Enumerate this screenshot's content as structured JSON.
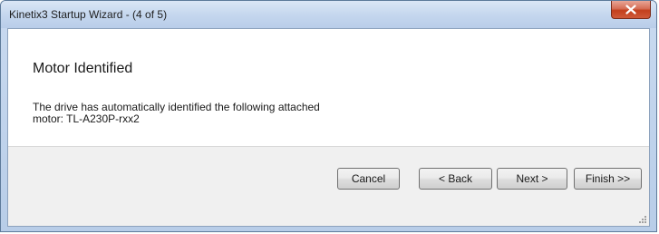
{
  "window": {
    "title": "Kinetix3 Startup Wizard - (4 of 5)",
    "close_icon": "close-icon"
  },
  "page": {
    "heading": "Motor Identified",
    "line1": "The drive has automatically identified the following attached",
    "line2": "motor: TL-A230P-rxx2"
  },
  "buttons": {
    "cancel": "Cancel",
    "back": "< Back",
    "next": "Next >",
    "finish": "Finish >>"
  },
  "colors": {
    "title_bar": "#c5d7ee",
    "close_button": "#c33f1c",
    "content_bg": "#ffffff",
    "footer_bg": "#f0f0f0"
  }
}
